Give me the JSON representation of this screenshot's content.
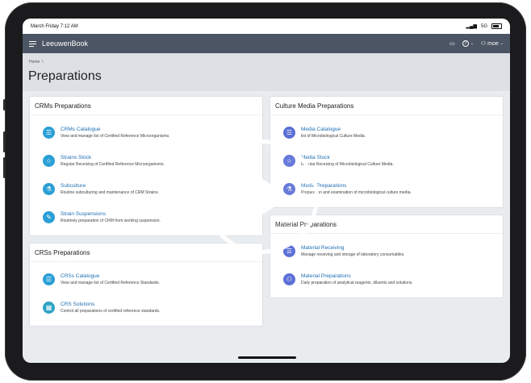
{
  "status_bar": {
    "time": "March Friday 7:12 AM",
    "signal": "5G",
    "battery": ""
  },
  "app": {
    "title": "LeeuwenBook",
    "user": "moe"
  },
  "breadcrumb": {
    "home": "Home"
  },
  "page": {
    "title": "Preparations"
  },
  "left_column": {
    "crms": {
      "title": "CRMs Preparations",
      "items": [
        {
          "label": "CRMs Catalogue",
          "desc": "View and manage list of Certified Reference Microorganisms.",
          "icon": "list-icon"
        },
        {
          "label": "Strains Stock",
          "desc": "Regular Receiving of Certified Reference Microorganisms.",
          "icon": "star-icon"
        },
        {
          "label": "Subculture",
          "desc": "Routine subculturing and maintenance of CRM Strains.",
          "icon": "flask-icon"
        },
        {
          "label": "Strain Suspensions",
          "desc": "Routinely preparation of CRM from working suspension.",
          "icon": "pipette-icon"
        }
      ]
    },
    "crss": {
      "title": "CRSs Preparations",
      "items": [
        {
          "label": "CRSs Catalogue",
          "desc": "View and manage list of Certified Reference Standards.",
          "icon": "list-icon"
        },
        {
          "label": "CRS Solutions",
          "desc": "Control all preparations of certified reference standards.",
          "icon": "grid-icon"
        }
      ]
    }
  },
  "right_column": {
    "culture": {
      "title": "Culture Media Preparations",
      "items": [
        {
          "label": "Media Catalogue",
          "desc": "list of Microbiological Culture Media.",
          "icon": "list-icon"
        },
        {
          "label": "Media Stock",
          "desc": "Regular Receiving of Microbiological Culture Media.",
          "icon": "star-icon"
        },
        {
          "label": "Media Preparations",
          "desc": "Preparation and examination of microbiological culture media.",
          "icon": "beaker-icon"
        }
      ]
    },
    "material": {
      "title": "Material Preparations",
      "items": [
        {
          "label": "Material Receiving",
          "desc": "Manage receiving and storage of laboratory consumables.",
          "icon": "list-icon"
        },
        {
          "label": "Material Preparations",
          "desc": "Daily preparation of analytical reagents, diluents and solutions.",
          "icon": "person-icon"
        }
      ]
    }
  },
  "colors": {
    "appbar": "#4b5563",
    "link": "#1f6fb2",
    "icon": "#2a9fd6"
  }
}
